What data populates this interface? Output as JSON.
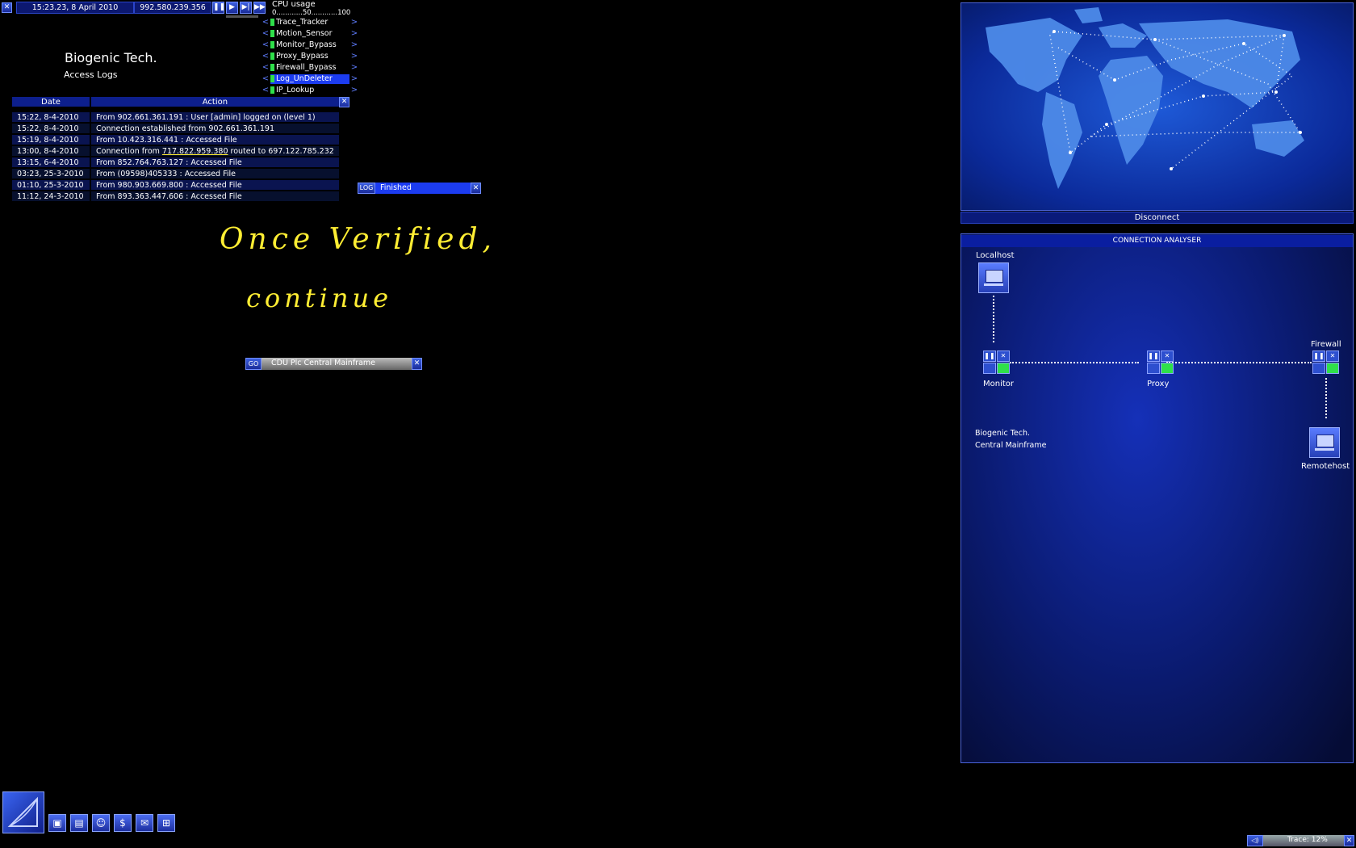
{
  "topbar": {
    "datetime": "15:23.23, 8 April 2010",
    "ip": "992.580.239.356",
    "speed_buttons": [
      "pause",
      "play",
      "fast",
      "fastest"
    ]
  },
  "cpu": {
    "title": "CPU usage",
    "scale": "0............50............100"
  },
  "programs": [
    {
      "label": "Trace_Tracker",
      "active": false
    },
    {
      "label": "Motion_Sensor",
      "active": false
    },
    {
      "label": "Monitor_Bypass",
      "active": false
    },
    {
      "label": "Proxy_Bypass",
      "active": false
    },
    {
      "label": "Firewall_Bypass",
      "active": false
    },
    {
      "label": "Log_UnDeleter",
      "active": true
    },
    {
      "label": "IP_Lookup",
      "active": false
    }
  ],
  "company": {
    "name": "Biogenic Tech.",
    "subtitle": "Access Logs"
  },
  "log_table": {
    "headers": [
      "Date",
      "Action"
    ],
    "rows": [
      {
        "date": "15:22, 8-4-2010",
        "action": "From 902.661.361.191 : User [admin] logged on (level 1)"
      },
      {
        "date": "15:22, 8-4-2010",
        "action": "Connection established from 902.661.361.191"
      },
      {
        "date": "15:19, 8-4-2010",
        "action": "From 10.423.316.441 : Accessed File"
      },
      {
        "date": "13:00, 8-4-2010",
        "action_prefix": "Connection from ",
        "action_highlight": "717.822.959.380",
        "action_suffix": " routed to 697.122.785.232"
      },
      {
        "date": "13:15, 6-4-2010",
        "action": "From 852.764.763.127 : Accessed File"
      },
      {
        "date": "03:23, 25-3-2010",
        "action": "From (09598)405333 : Accessed File"
      },
      {
        "date": "01:10, 25-3-2010",
        "action": "From 980.903.669.800 : Accessed File"
      },
      {
        "date": "11:12, 24-3-2010",
        "action": "From 893.363.447.606 : Accessed File"
      }
    ]
  },
  "log_task": {
    "tag": "LOG",
    "status": "Finished",
    "progress": 1.0
  },
  "handwriting": {
    "line1": "Once Verified,",
    "line2": "continue"
  },
  "goto_task": {
    "tag": "GO",
    "label": "CDU Plc Central Mainframe"
  },
  "world_map": {
    "disconnect_label": "Disconnect"
  },
  "analyser": {
    "title": "CONNECTION ANALYSER",
    "localhost": "Localhost",
    "monitor": "Monitor",
    "proxy": "Proxy",
    "firewall": "Firewall",
    "remotehost": "Remotehost",
    "target_line1": "Biogenic Tech.",
    "target_line2": "Central Mainframe"
  },
  "taskbar": {
    "icons": [
      "hardware-icon",
      "files-icon",
      "person-icon",
      "finance-icon",
      "email-icon",
      "network-icon"
    ]
  },
  "trace": {
    "label": "Trace: 12%",
    "percent": 12
  },
  "colors": {
    "accent": "#2a44c8",
    "panel_bg": "#0a1ea0",
    "led_green": "#2fe04a",
    "handwriting": "#ffee33"
  }
}
